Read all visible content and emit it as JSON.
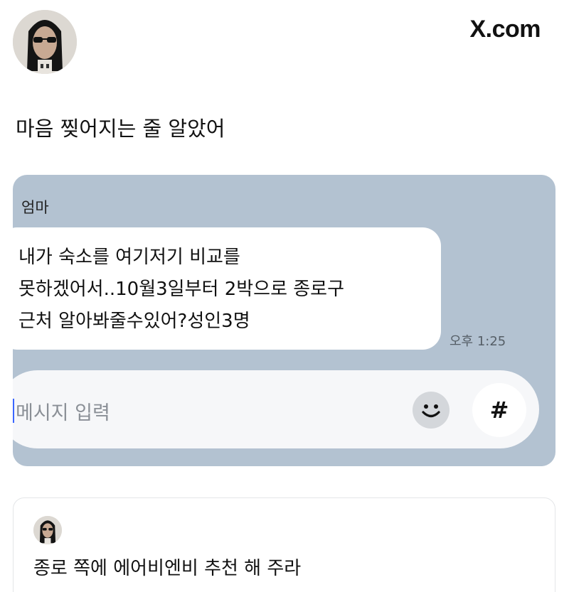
{
  "header": {
    "brand": "X.com",
    "avatar_icon": "profile-avatar"
  },
  "post": {
    "text": "마음 찢어지는 줄 알았어"
  },
  "chat": {
    "background": "#b3c2d1",
    "sender": "엄마",
    "message_lines": [
      "내가 숙소를 여기저기 비교를",
      "못하겠어서..10월3일부터 2박으로 종로구",
      "근처 알아봐줄수있어?성인3명"
    ],
    "time": "오후 1:25",
    "input_placeholder": "메시지 입력",
    "emoji_icon": "smile-icon",
    "hash_label": "#"
  },
  "reply": {
    "text": "종로 쪽에 에어비엔비 추천 해 주라"
  }
}
